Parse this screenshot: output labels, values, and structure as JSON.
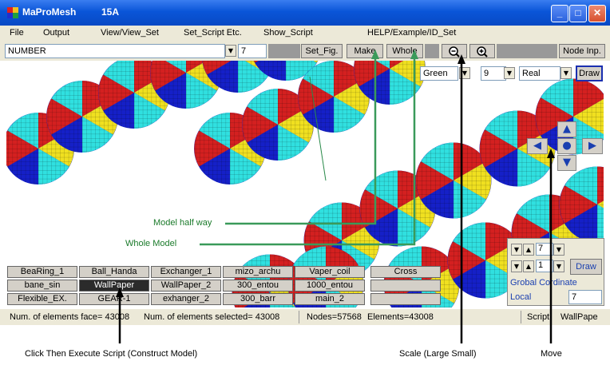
{
  "window": {
    "app_title": "MaProMesh",
    "version": "15A",
    "minimize": "_",
    "maximize": "□",
    "close": "✕"
  },
  "menu": [
    "File",
    "Output",
    "View/View_Set",
    "Set_Script Etc.",
    "Show_Script",
    "HELP/Example/ID_Set"
  ],
  "toolbar": {
    "mode_select": "NUMBER",
    "number_value": "7",
    "set_fig": "Set_Fig.",
    "make": "Make",
    "whole": "Whole",
    "zoom_out_icon": "magnifier-minus",
    "zoom_in_icon": "magnifier-plus",
    "node_inp": "Node Inp."
  },
  "view_controls": {
    "color_select": "Green",
    "count_select": "9",
    "type_select": "Real",
    "draw": "Draw"
  },
  "nav": {
    "up": "▲",
    "down": "▼",
    "left": "◀",
    "right": "▶",
    "center": "●"
  },
  "scripts": [
    [
      "BeaRing_1",
      "Ball_Handa",
      "Exchanger_1",
      "mizo_archu",
      "Vaper_coil",
      "Cross"
    ],
    [
      "bane_sin",
      "WallPaper",
      "WallPaper_2",
      "300_entou",
      "1000_entou",
      ""
    ],
    [
      "Flexible_EX.",
      "GEAR-1",
      "exhanger_2",
      "300_barr",
      "main_2",
      ""
    ]
  ],
  "selected_script": "WallPaper",
  "panel": {
    "value1": "7",
    "value2": "1",
    "draw": "Draw",
    "global": "Grobal Cordinate",
    "local": "Local",
    "local_value": "7"
  },
  "status": {
    "faces": "Num. of elements face= 43008",
    "selected": "Num. of elements selected= 43008",
    "nodes": "Nodes=57568",
    "elements": "Elements=43008",
    "script_label": "Script",
    "script_name": "WallPape"
  },
  "annotations": {
    "model_half": "Model half way",
    "whole_model": "Whole Model",
    "click_execute": "Click Then Execute Script (Construct Model)",
    "scale": "Scale (Large Small)",
    "move": "Move"
  },
  "colors": {
    "red": "#d42020",
    "blue": "#1520c8",
    "cyan": "#30e0e0",
    "yellow": "#f0e020",
    "annot_green": "#3a9a5a"
  }
}
